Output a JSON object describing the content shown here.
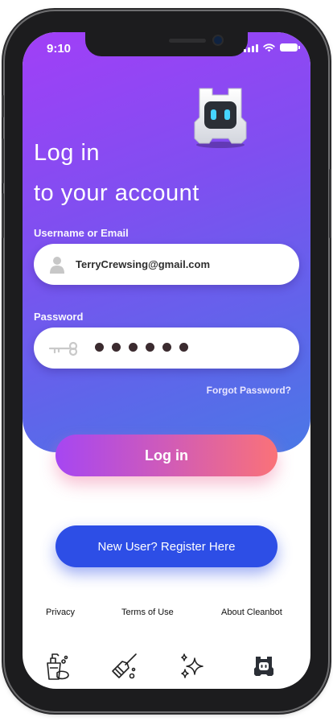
{
  "status_bar": {
    "time": "9:10"
  },
  "header": {
    "title_line1": "Log in",
    "title_line2": "to your account"
  },
  "form": {
    "username": {
      "label": "Username or Email",
      "value": "TerryCrewsing@gmail.com"
    },
    "password": {
      "label": "Password",
      "masked_length": 6
    },
    "forgot_label": "Forgot Password?"
  },
  "buttons": {
    "login_label": "Log in",
    "register_label": "New User?  Register Here"
  },
  "footer": {
    "privacy": "Privacy",
    "terms": "Terms of Use",
    "about": "About Cleanbot"
  },
  "tabbar": {
    "icons": [
      "cleaning-supplies-icon",
      "broom-icon",
      "sparkles-icon",
      "cleanbot-logo-icon"
    ]
  },
  "colors": {
    "gradient_top": "#a13ff7",
    "gradient_bottom": "#4a78e6",
    "login_start": "#a646f2",
    "login_end": "#fa7278",
    "register": "#2d4ee6"
  }
}
